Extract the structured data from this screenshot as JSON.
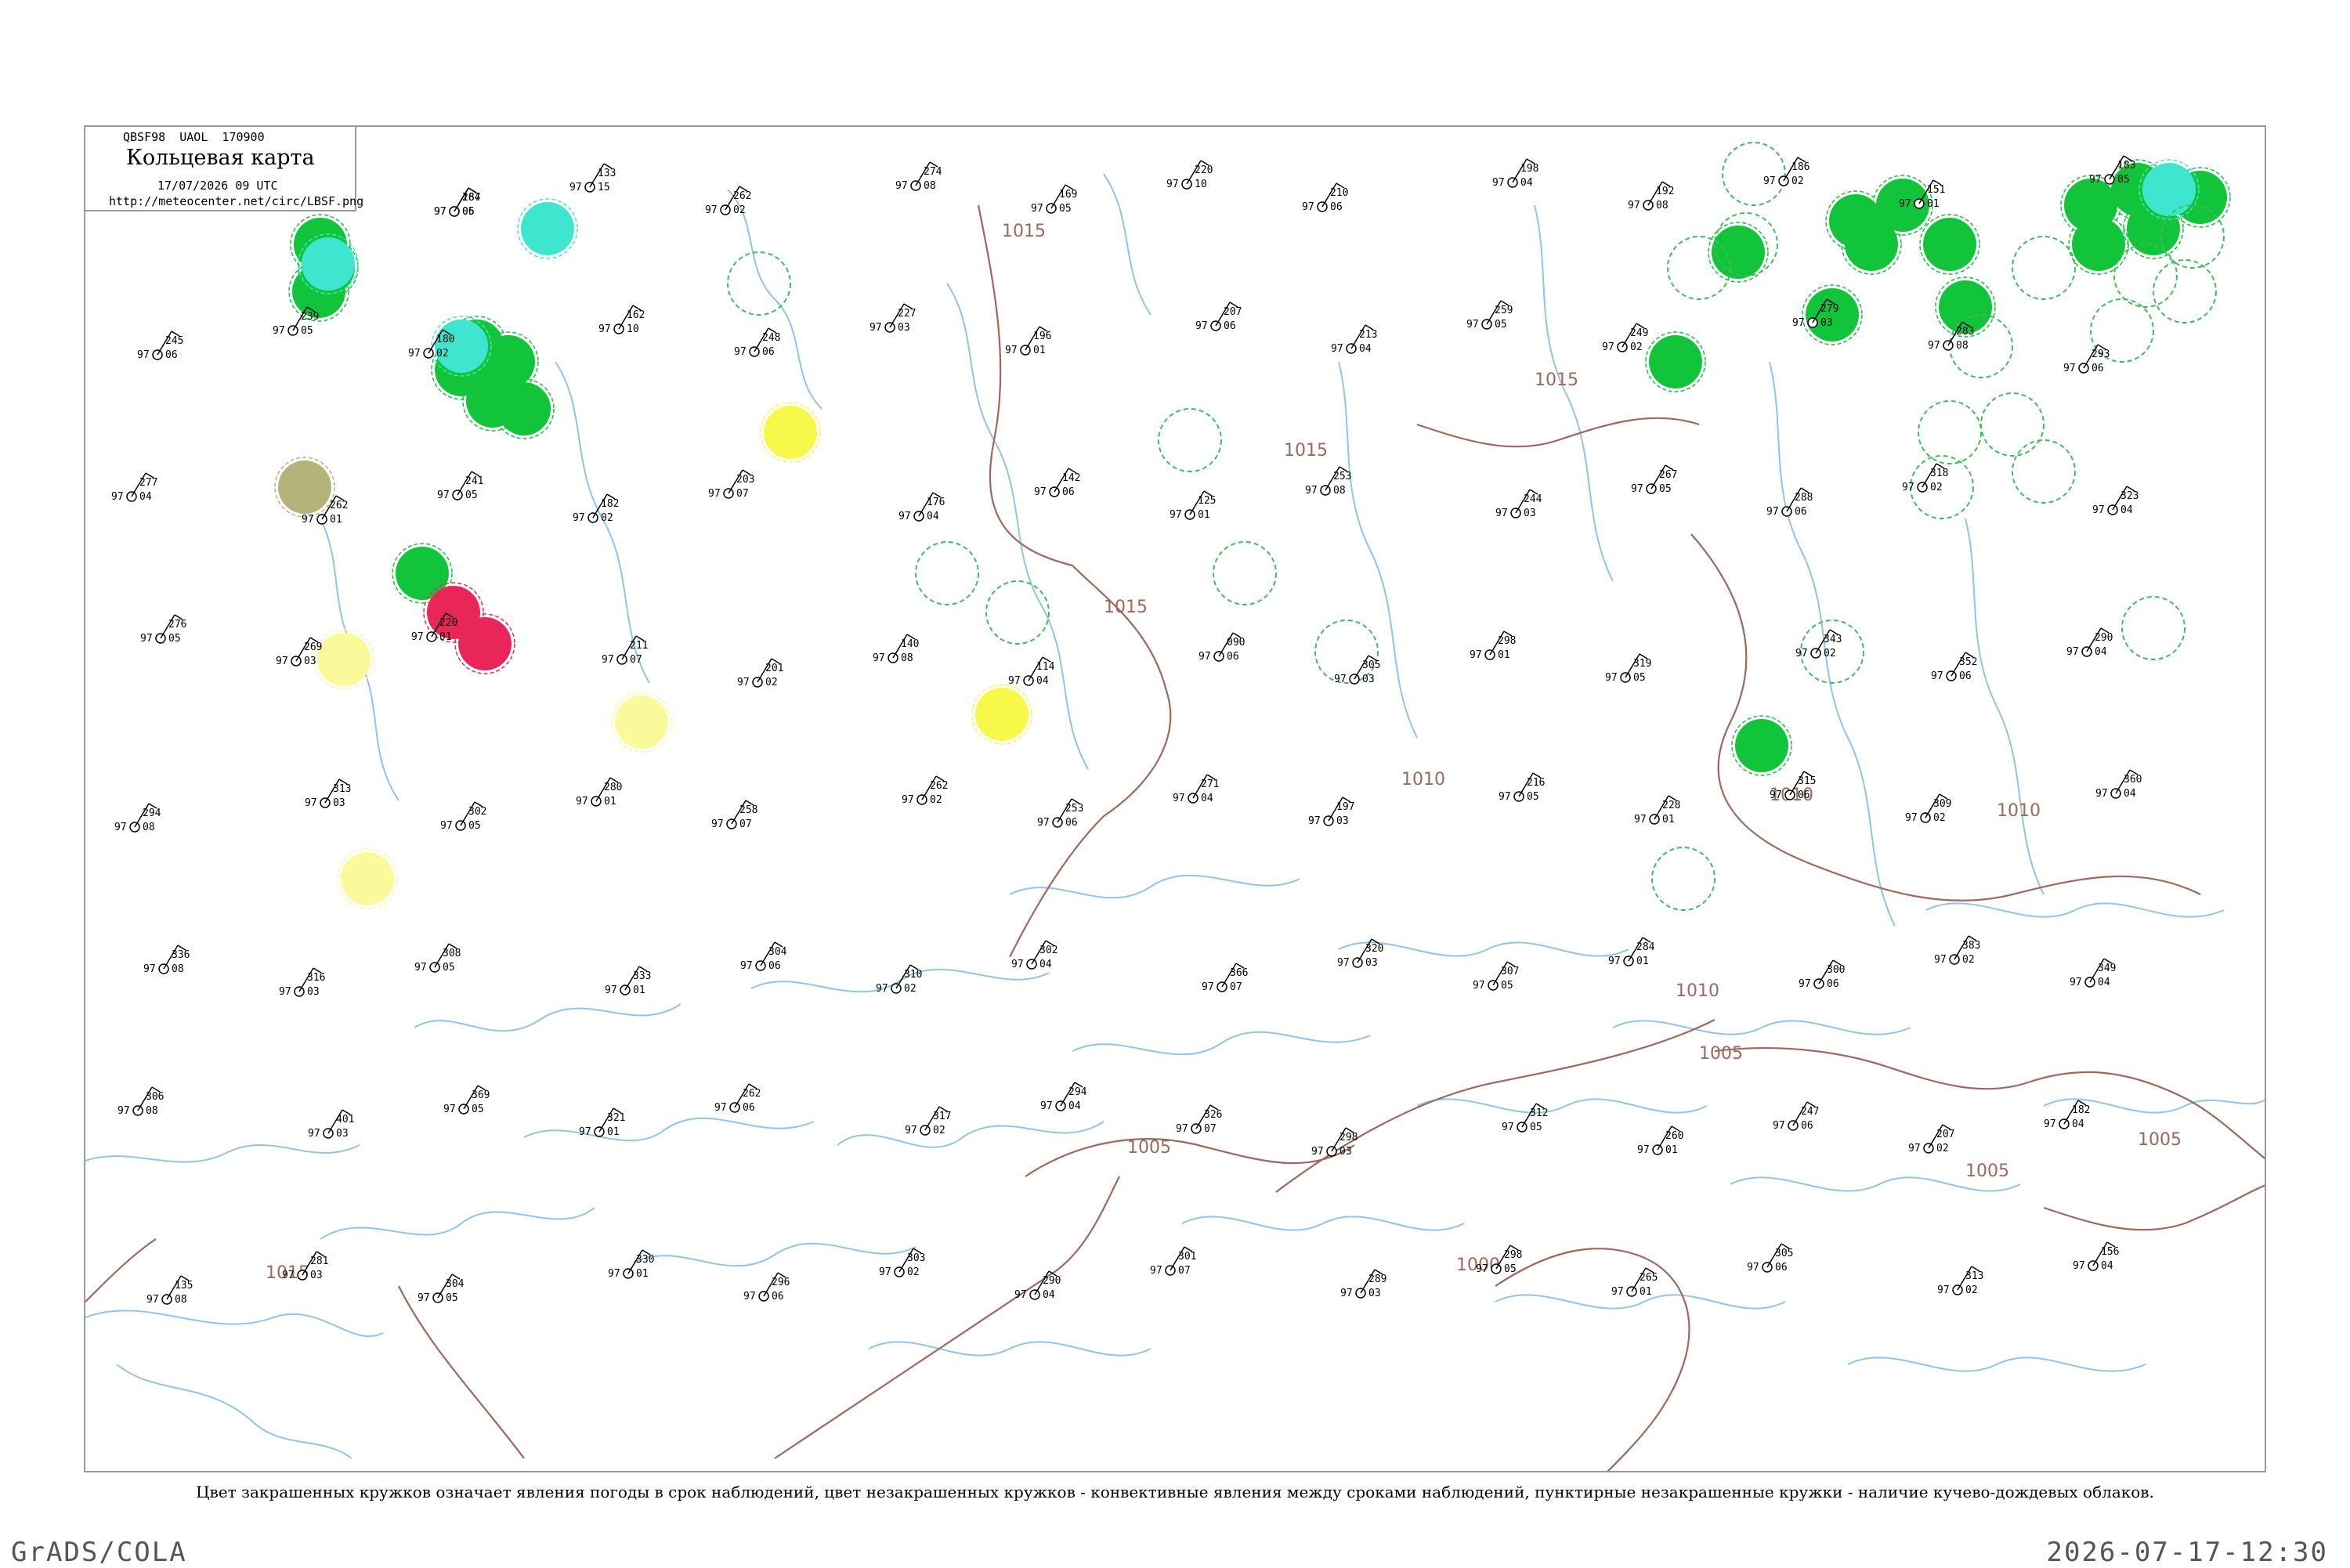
{
  "header": {
    "bulletin": "QBSF98  UAOL  170900",
    "title": "Кольцевая карта",
    "datetime": "17/07/2026 09 UTC",
    "url": "http://meteocenter.net/circ/LBSF.png"
  },
  "caption": "Цвет закрашенных кружков означает явления погоды в срок наблюдений, цвет незакрашенных кружков - конвективные явления между сроками наблюдений, пунктирные незакрашенные кружки - наличие кучево-дождевых облаков.",
  "footer": {
    "software": "GrADS/COLA",
    "timestamp": "2026-07-17-12:30"
  },
  "colors": {
    "isobar": "#a0685a",
    "river": "#8fc4ee",
    "station_text": "#000000",
    "station_id": "#8a8a8a",
    "rain": "#12c43a",
    "shower_ring": "#3cbf5a",
    "fog": "#b3b37a",
    "drizzle": "#3fe6cf",
    "thunder": "#e8265a",
    "haze": "#f8f84a",
    "haze_light": "#fafa9a"
  },
  "isobars": [
    "1015",
    "1015",
    "1015",
    "1015",
    "1010",
    "1010",
    "1010",
    "1010",
    "1005",
    "1005",
    "1005",
    "1005",
    "1000",
    "1015"
  ],
  "symbols": [
    {
      "kind": "rain"
    },
    {
      "kind": "rain"
    },
    {
      "kind": "rain"
    },
    {
      "kind": "rain"
    },
    {
      "kind": "rain"
    },
    {
      "kind": "rain"
    },
    {
      "kind": "rain"
    },
    {
      "kind": "rain"
    },
    {
      "kind": "rain"
    },
    {
      "kind": "rain"
    },
    {
      "kind": "rain"
    },
    {
      "kind": "rain"
    },
    {
      "kind": "rain"
    },
    {
      "kind": "rain"
    },
    {
      "kind": "rain"
    },
    {
      "kind": "rain"
    },
    {
      "kind": "rain"
    },
    {
      "kind": "rain"
    },
    {
      "kind": "rain"
    },
    {
      "kind": "rain"
    },
    {
      "kind": "rain"
    },
    {
      "kind": "rain"
    },
    {
      "kind": "rain"
    },
    {
      "kind": "drizzle"
    },
    {
      "kind": "drizzle"
    },
    {
      "kind": "drizzle"
    },
    {
      "kind": "drizzle"
    },
    {
      "kind": "fog"
    },
    {
      "kind": "thunder"
    },
    {
      "kind": "thunder"
    },
    {
      "kind": "haze"
    },
    {
      "kind": "haze"
    },
    {
      "kind": "haze_light"
    },
    {
      "kind": "haze_light"
    },
    {
      "kind": "haze_light"
    },
    {
      "kind": "cb"
    },
    {
      "kind": "cb"
    },
    {
      "kind": "cb"
    },
    {
      "kind": "cb"
    },
    {
      "kind": "cb"
    },
    {
      "kind": "cb"
    },
    {
      "kind": "cb"
    },
    {
      "kind": "cb"
    },
    {
      "kind": "cb"
    },
    {
      "kind": "cb"
    },
    {
      "kind": "cb"
    },
    {
      "kind": "cb"
    },
    {
      "kind": "cb"
    },
    {
      "kind": "cb"
    },
    {
      "kind": "cb"
    },
    {
      "kind": "cb"
    },
    {
      "kind": "cb"
    },
    {
      "kind": "cb"
    },
    {
      "kind": "cb"
    },
    {
      "kind": "cb"
    },
    {
      "kind": "cb"
    },
    {
      "kind": "cb"
    }
  ],
  "stations": [
    {
      "p": "231",
      "t": "97",
      "d": "05"
    },
    {
      "p": "122",
      "t": "97",
      "d": "01"
    },
    {
      "p": "267",
      "t": "97",
      "d": "06"
    },
    {
      "p": "133",
      "t": "97",
      "d": "15"
    },
    {
      "p": "262",
      "t": "97",
      "d": "02"
    },
    {
      "p": "274",
      "t": "97",
      "d": "08"
    },
    {
      "p": "169",
      "t": "97",
      "d": "05"
    },
    {
      "p": "220",
      "t": "97",
      "d": "10"
    },
    {
      "p": "210",
      "t": "97",
      "d": "06"
    },
    {
      "p": "198",
      "t": "97",
      "d": "04"
    },
    {
      "p": "192",
      "t": "97",
      "d": "08"
    },
    {
      "p": "186",
      "t": "97",
      "d": "02"
    },
    {
      "p": "151",
      "t": "97",
      "d": "01"
    },
    {
      "p": "183",
      "t": "97",
      "d": "05"
    },
    {
      "p": "245",
      "t": "97",
      "d": "06"
    },
    {
      "p": "239",
      "t": "97",
      "d": "05"
    },
    {
      "p": "180",
      "t": "97",
      "d": "02"
    },
    {
      "p": "162",
      "t": "97",
      "d": "10"
    },
    {
      "p": "248",
      "t": "97",
      "d": "06"
    },
    {
      "p": "227",
      "t": "97",
      "d": "03"
    },
    {
      "p": "196",
      "t": "97",
      "d": "01"
    },
    {
      "p": "207",
      "t": "97",
      "d": "06"
    },
    {
      "p": "213",
      "t": "97",
      "d": "04"
    },
    {
      "p": "259",
      "t": "97",
      "d": "05"
    },
    {
      "p": "249",
      "t": "97",
      "d": "02"
    },
    {
      "p": "279",
      "t": "97",
      "d": "03"
    },
    {
      "p": "283",
      "t": "97",
      "d": "08"
    },
    {
      "p": "293",
      "t": "97",
      "d": "06"
    },
    {
      "p": "277",
      "t": "97",
      "d": "04"
    },
    {
      "p": "262",
      "t": "97",
      "d": "01"
    },
    {
      "p": "241",
      "t": "97",
      "d": "05"
    },
    {
      "p": "182",
      "t": "97",
      "d": "02"
    },
    {
      "p": "203",
      "t": "97",
      "d": "07"
    },
    {
      "p": "176",
      "t": "97",
      "d": "04"
    },
    {
      "p": "142",
      "t": "97",
      "d": "06"
    },
    {
      "p": "125",
      "t": "97",
      "d": "01"
    },
    {
      "p": "253",
      "t": "97",
      "d": "08"
    },
    {
      "p": "244",
      "t": "97",
      "d": "03"
    },
    {
      "p": "267",
      "t": "97",
      "d": "05"
    },
    {
      "p": "288",
      "t": "97",
      "d": "06"
    },
    {
      "p": "318",
      "t": "97",
      "d": "02"
    },
    {
      "p": "323",
      "t": "97",
      "d": "04"
    },
    {
      "p": "276",
      "t": "97",
      "d": "05"
    },
    {
      "p": "269",
      "t": "97",
      "d": "03"
    },
    {
      "p": "220",
      "t": "97",
      "d": "01"
    },
    {
      "p": "211",
      "t": "97",
      "d": "07"
    },
    {
      "p": "201",
      "t": "97",
      "d": "02"
    },
    {
      "p": "140",
      "t": "97",
      "d": "08"
    },
    {
      "p": "114",
      "t": "97",
      "d": "04"
    },
    {
      "p": "090",
      "t": "97",
      "d": "06"
    },
    {
      "p": "305",
      "t": "97",
      "d": "03"
    },
    {
      "p": "298",
      "t": "97",
      "d": "01"
    },
    {
      "p": "319",
      "t": "97",
      "d": "05"
    },
    {
      "p": "343",
      "t": "97",
      "d": "02"
    },
    {
      "p": "352",
      "t": "97",
      "d": "06"
    },
    {
      "p": "290",
      "t": "97",
      "d": "04"
    },
    {
      "p": "294",
      "t": "97",
      "d": "08"
    },
    {
      "p": "313",
      "t": "97",
      "d": "03"
    },
    {
      "p": "302",
      "t": "97",
      "d": "05"
    },
    {
      "p": "280",
      "t": "97",
      "d": "01"
    },
    {
      "p": "258",
      "t": "97",
      "d": "07"
    },
    {
      "p": "262",
      "t": "97",
      "d": "02"
    },
    {
      "p": "253",
      "t": "97",
      "d": "06"
    },
    {
      "p": "271",
      "t": "97",
      "d": "04"
    },
    {
      "p": "197",
      "t": "97",
      "d": "03"
    },
    {
      "p": "216",
      "t": "97",
      "d": "05"
    },
    {
      "p": "228",
      "t": "97",
      "d": "01"
    },
    {
      "p": "315",
      "t": "97",
      "d": "06"
    },
    {
      "p": "309",
      "t": "97",
      "d": "02"
    },
    {
      "p": "360",
      "t": "97",
      "d": "04"
    },
    {
      "p": "336",
      "t": "97",
      "d": "08"
    },
    {
      "p": "316",
      "t": "97",
      "d": "03"
    },
    {
      "p": "308",
      "t": "97",
      "d": "05"
    },
    {
      "p": "333",
      "t": "97",
      "d": "01"
    },
    {
      "p": "304",
      "t": "97",
      "d": "06"
    },
    {
      "p": "310",
      "t": "97",
      "d": "02"
    },
    {
      "p": "302",
      "t": "97",
      "d": "04"
    },
    {
      "p": "366",
      "t": "97",
      "d": "07"
    },
    {
      "p": "320",
      "t": "97",
      "d": "03"
    },
    {
      "p": "307",
      "t": "97",
      "d": "05"
    },
    {
      "p": "284",
      "t": "97",
      "d": "01"
    },
    {
      "p": "300",
      "t": "97",
      "d": "06"
    },
    {
      "p": "383",
      "t": "97",
      "d": "02"
    },
    {
      "p": "349",
      "t": "97",
      "d": "04"
    },
    {
      "p": "306",
      "t": "97",
      "d": "08"
    },
    {
      "p": "401",
      "t": "97",
      "d": "03"
    },
    {
      "p": "369",
      "t": "97",
      "d": "05"
    },
    {
      "p": "321",
      "t": "97",
      "d": "01"
    },
    {
      "p": "262",
      "t": "97",
      "d": "06"
    },
    {
      "p": "317",
      "t": "97",
      "d": "02"
    },
    {
      "p": "294",
      "t": "97",
      "d": "04"
    },
    {
      "p": "326",
      "t": "97",
      "d": "07"
    },
    {
      "p": "298",
      "t": "97",
      "d": "03"
    },
    {
      "p": "312",
      "t": "97",
      "d": "05"
    },
    {
      "p": "260",
      "t": "97",
      "d": "01"
    },
    {
      "p": "247",
      "t": "97",
      "d": "06"
    },
    {
      "p": "207",
      "t": "97",
      "d": "02"
    },
    {
      "p": "182",
      "t": "97",
      "d": "04"
    },
    {
      "p": "135",
      "t": "97",
      "d": "08"
    },
    {
      "p": "281",
      "t": "97",
      "d": "03"
    },
    {
      "p": "304",
      "t": "97",
      "d": "05"
    },
    {
      "p": "330",
      "t": "97",
      "d": "01"
    },
    {
      "p": "296",
      "t": "97",
      "d": "06"
    },
    {
      "p": "303",
      "t": "97",
      "d": "02"
    },
    {
      "p": "290",
      "t": "97",
      "d": "04"
    },
    {
      "p": "301",
      "t": "97",
      "d": "07"
    },
    {
      "p": "289",
      "t": "97",
      "d": "03"
    },
    {
      "p": "298",
      "t": "97",
      "d": "05"
    },
    {
      "p": "265",
      "t": "97",
      "d": "01"
    },
    {
      "p": "305",
      "t": "97",
      "d": "06"
    },
    {
      "p": "313",
      "t": "97",
      "d": "02"
    },
    {
      "p": "156",
      "t": "97",
      "d": "04"
    },
    {
      "p": "267",
      "t": "97",
      "d": "08"
    },
    {
      "p": "241",
      "t": "97",
      "d": "03"
    },
    {
      "p": "184",
      "t": "97",
      "d": "05"
    }
  ]
}
